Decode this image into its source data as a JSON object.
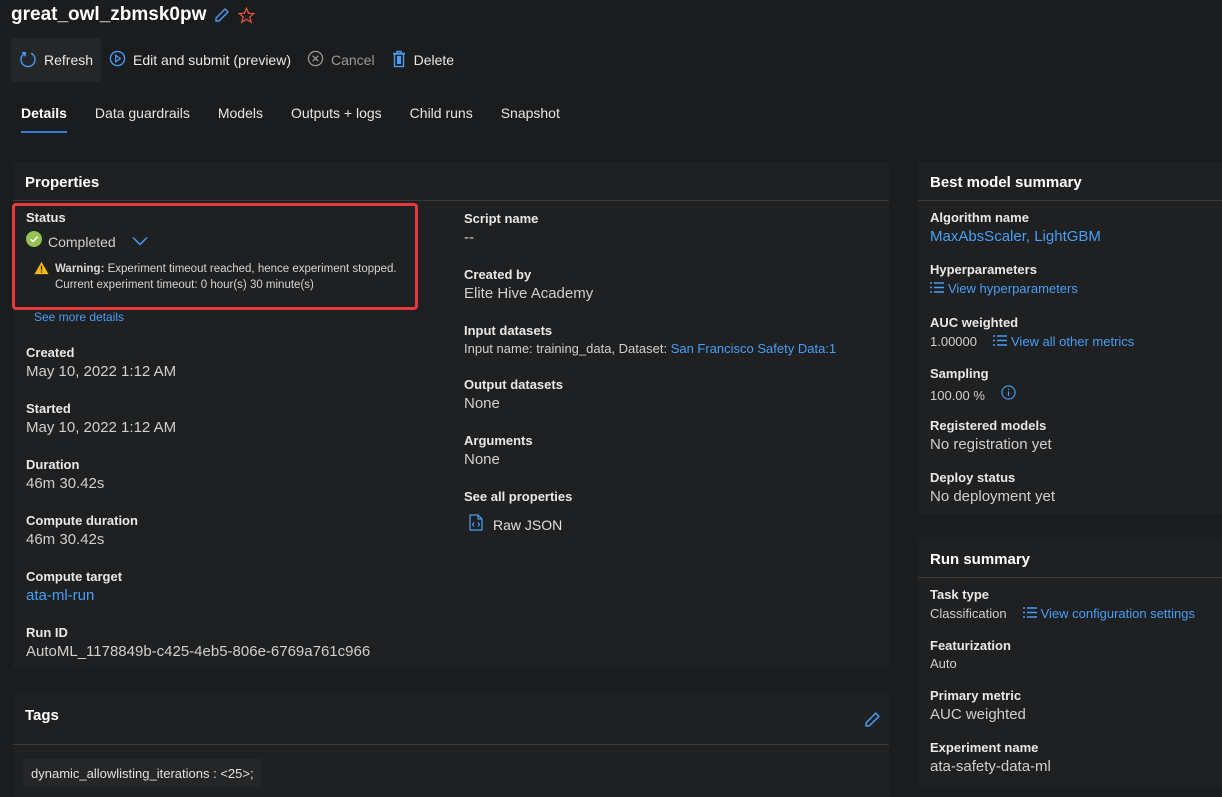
{
  "header": {
    "title": "great_owl_zbmsk0pw"
  },
  "toolbar": {
    "refresh": "Refresh",
    "edit_submit": "Edit and submit (preview)",
    "cancel": "Cancel",
    "delete": "Delete"
  },
  "tabs": [
    {
      "label": "Details",
      "active": true
    },
    {
      "label": "Data guardrails"
    },
    {
      "label": "Models"
    },
    {
      "label": "Outputs + logs"
    },
    {
      "label": "Child runs"
    },
    {
      "label": "Snapshot"
    }
  ],
  "properties": {
    "header": "Properties",
    "status_label": "Status",
    "status_value": "Completed",
    "warning_prefix": "Warning:",
    "warning_text": " Experiment timeout reached, hence experiment stopped.",
    "warning_line2": "Current experiment timeout: 0 hour(s) 30 minute(s)",
    "see_more": "See more details",
    "created_label": "Created",
    "created_value": "May 10, 2022 1:12 AM",
    "started_label": "Started",
    "started_value": "May 10, 2022 1:12 AM",
    "duration_label": "Duration",
    "duration_value": "46m 30.42s",
    "compute_duration_label": "Compute duration",
    "compute_duration_value": "46m 30.42s",
    "compute_target_label": "Compute target",
    "compute_target_value": "ata-ml-run",
    "run_id_label": "Run ID",
    "run_id_value": "AutoML_1178849b-c425-4eb5-806e-6769a761c966",
    "script_name_label": "Script name",
    "script_name_value": "--",
    "created_by_label": "Created by",
    "created_by_value": "Elite Hive Academy",
    "input_datasets_label": "Input datasets",
    "input_datasets_prefix": "Input name: training_data, Dataset: ",
    "input_datasets_link": "San Francisco Safety Data:1",
    "output_datasets_label": "Output datasets",
    "output_datasets_value": "None",
    "arguments_label": "Arguments",
    "arguments_value": "None",
    "see_all_label": "See all properties",
    "raw_json": "Raw JSON"
  },
  "tags": {
    "header": "Tags",
    "items": [
      "dynamic_allowlisting_iterations : <25>;"
    ]
  },
  "best_model": {
    "header": "Best model summary",
    "algorithm_label": "Algorithm name",
    "algorithm_value": "MaxAbsScaler, LightGBM",
    "hyper_label": "Hyperparameters",
    "hyper_link": "View hyperparameters",
    "auc_label": "AUC weighted",
    "auc_value": "1.00000",
    "metrics_link": "View all other metrics",
    "sampling_label": "Sampling",
    "sampling_value": "100.00 %",
    "registered_label": "Registered models",
    "registered_value": "No registration yet",
    "deploy_label": "Deploy status",
    "deploy_value": "No deployment yet"
  },
  "run_summary": {
    "header": "Run summary",
    "task_label": "Task type",
    "task_value": "Classification",
    "config_link": "View configuration settings",
    "featurization_label": "Featurization",
    "featurization_value": "Auto",
    "primary_metric_label": "Primary metric",
    "primary_metric_value": "AUC weighted",
    "experiment_label": "Experiment name",
    "experiment_value": "ata-safety-data-ml"
  }
}
